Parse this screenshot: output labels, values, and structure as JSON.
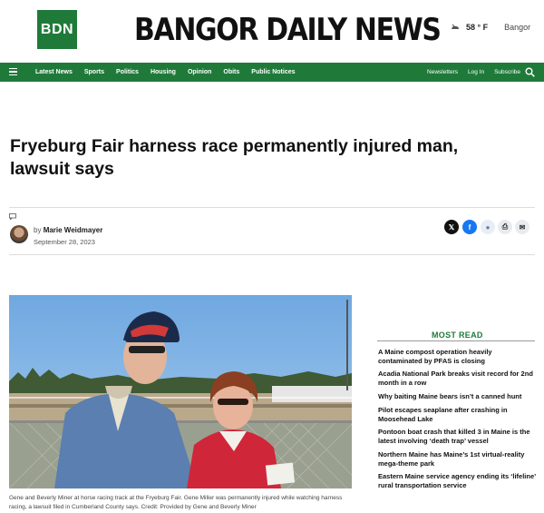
{
  "header": {
    "logo_text": "BDN",
    "masthead": "BANGOR DAILY NEWS",
    "weather_temp": "58 ° F",
    "weather_city": "Bangor",
    "weather_icon": "weather-icon",
    "brand_color": "#1f7a3a"
  },
  "nav": {
    "menu_icon": "menu-icon",
    "links": [
      "Latest News",
      "Sports",
      "Politics",
      "Housing",
      "Opinion",
      "Obits",
      "Public Notices"
    ],
    "right": [
      "Newsletters",
      "Log In",
      "Subscribe"
    ],
    "search_icon": "search-icon"
  },
  "article": {
    "headline": "Fryeburg Fair harness race permanently injured man, lawsuit says",
    "by_prefix": "by",
    "author": "Marie Weidmayer",
    "date": "September 28, 2023",
    "caption": "Gene and Beverly Miner at horse racing track at the Fryeburg Fair. Gene Miller was permanently injured while watching harness racing, a lawsuit filed in Cumberland County says. Credit: Provided by Gene and Beverly Miner"
  },
  "share": {
    "x": "𝕏",
    "facebook": "f",
    "reddit": "●",
    "print": "⎙",
    "mail": "✉"
  },
  "most_read": {
    "title": "MOST READ",
    "items": [
      "A Maine compost operation heavily contaminated by PFAS is closing",
      "Acadia National Park breaks visit record for 2nd month in a row",
      "Why baiting Maine bears isn’t a canned hunt",
      "Pilot escapes seaplane after crashing in Moosehead Lake",
      "Pontoon boat crash that killed 3 in Maine is the latest involving ‘death trap’ vessel",
      "Northern Maine has Maine’s 1st virtual-reality mega-theme park",
      "Eastern Maine service agency ending its ‘lifeline’ rural transportation service"
    ]
  }
}
